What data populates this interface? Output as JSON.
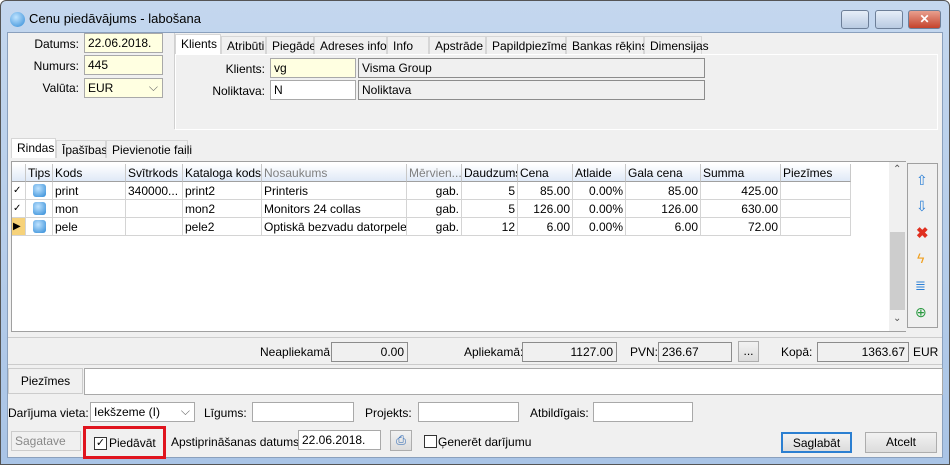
{
  "window": {
    "title": "Cenu piedāvājums - labošana",
    "minimize": "–",
    "maximize": "□",
    "close": "✕"
  },
  "header": {
    "datums_label": "Datums:",
    "datums": "22.06.2018.",
    "numurs_label": "Numurs:",
    "numurs": "445",
    "valuta_label": "Valūta:",
    "valuta": "EUR"
  },
  "top_tabs": [
    "Klients",
    "Atribūti",
    "Piegāde",
    "Adreses info",
    "Info",
    "Apstrāde",
    "Papildpiezīmes",
    "Bankas rēķins",
    "Dimensijas"
  ],
  "client_tab": {
    "klients_label": "Klients:",
    "klients_code": "vg",
    "klients_name": "Visma Group",
    "noliktava_label": "Noliktava:",
    "noliktava_code": "N",
    "noliktava_name": "Noliktava"
  },
  "lower_tabs": [
    "Rindas",
    "Īpašības",
    "Pievienotie faili"
  ],
  "grid": {
    "columns": [
      "Tips",
      "Kods",
      "Svītrkods",
      "Kataloga kods",
      "Nosaukums",
      "Mērvien...",
      "Daudzums",
      "Cena",
      "Atlaide",
      "Gala cena",
      "Summa",
      "Piezīmes"
    ],
    "rows": [
      {
        "marker": "✓",
        "kods": "print",
        "svitrkods": "340000...",
        "kataloga": "print2",
        "nosaukums": "Printeris",
        "mervien": "gab.",
        "daudzums": "5",
        "cena": "85.00",
        "atlaide": "0.00%",
        "gala": "85.00",
        "summa": "425.00",
        "piezimes": ""
      },
      {
        "marker": "✓",
        "kods": "mon",
        "svitrkods": "",
        "kataloga": "mon2",
        "nosaukums": "Monitors 24 collas",
        "mervien": "gab.",
        "daudzums": "5",
        "cena": "126.00",
        "atlaide": "0.00%",
        "gala": "126.00",
        "summa": "630.00",
        "piezimes": ""
      },
      {
        "marker": "▶",
        "kods": "pele",
        "svitrkods": "",
        "kataloga": "pele2",
        "nosaukums": "Optiskā bezvadu datorpele",
        "mervien": "gab.",
        "daudzums": "12",
        "cena": "6.00",
        "atlaide": "0.00%",
        "gala": "6.00",
        "summa": "72.00",
        "piezimes": ""
      }
    ]
  },
  "totals": {
    "neapliekama_label": "Neapliekamā:",
    "neapliekama": "0.00",
    "apliekama_label": "Apliekamā:",
    "apliekama": "1127.00",
    "pvn_label": "PVN:",
    "pvn": "236.67",
    "more": "...",
    "kopa_label": "Kopā:",
    "kopa": "1363.67",
    "currency": "EUR"
  },
  "notes": {
    "label": "Piezīmes",
    "value": ""
  },
  "deal": {
    "vieta_label": "Darījuma vieta:",
    "vieta": "Iekšzeme (I)",
    "ligums_label": "Līgums:",
    "projekts_label": "Projekts:",
    "atbildigais_label": "Atbildīgais:"
  },
  "footer": {
    "status": "Sagatave",
    "piedavat": "Piedāvāt",
    "piedavat_checked": true,
    "apst_label": "Apstiprināšanas datums:",
    "apst_date": "22.06.2018.",
    "generet": "Ģenerēt darījumu",
    "generet_checked": false,
    "save": "Saglabāt",
    "cancel": "Atcelt"
  },
  "colors": {
    "highlight": "#e0141e",
    "input_yellow": "#ffffe1"
  }
}
